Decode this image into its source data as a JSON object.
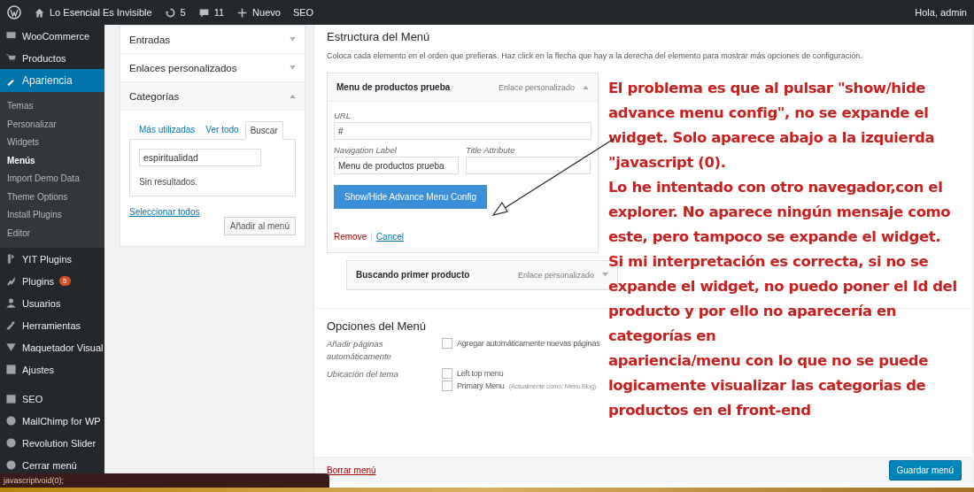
{
  "top_bar": {
    "site": "Lo Esencial Es Invisible",
    "updates": "5",
    "comments": "11",
    "new": "Nuevo",
    "seo": "SEO",
    "greeting": "Hola, admin"
  },
  "sidebar": {
    "items": [
      {
        "label": "WooCommerce",
        "selected": false
      },
      {
        "label": "Productos",
        "selected": false
      },
      {
        "label": "Apariencia",
        "selected": true,
        "children": [
          {
            "label": "Temas",
            "selected": false
          },
          {
            "label": "Personalizar",
            "selected": false
          },
          {
            "label": "Widgets",
            "selected": false
          },
          {
            "label": "Menús",
            "selected": true
          },
          {
            "label": "Import Demo Data",
            "selected": false
          },
          {
            "label": "Theme Options",
            "selected": false
          },
          {
            "label": "Install Plugins",
            "selected": false
          },
          {
            "label": "Editor",
            "selected": false
          }
        ]
      },
      {
        "label": "YIT Plugins",
        "selected": false
      },
      {
        "label": "Plugins",
        "selected": false,
        "badge": "5"
      },
      {
        "label": "Usuarios",
        "selected": false
      },
      {
        "label": "Herramientas",
        "selected": false
      },
      {
        "label": "Maquetador Visual",
        "selected": false
      },
      {
        "label": "Ajustes",
        "selected": false
      },
      {
        "label": "SEO",
        "selected": false,
        "separated": true
      },
      {
        "label": "MailChimp for WP",
        "selected": false
      },
      {
        "label": "Revolution Slider",
        "selected": false
      },
      {
        "label": "Cerrar menú",
        "selected": false
      }
    ]
  },
  "add_panel": {
    "sections": [
      {
        "title": "Entradas",
        "expanded": false
      },
      {
        "title": "Enlaces personalizados",
        "expanded": false
      },
      {
        "title": "Categorías",
        "expanded": true,
        "tabs": [
          {
            "label": "Más utilizadas",
            "selected": false
          },
          {
            "label": "Ver todo",
            "selected": false
          },
          {
            "label": "Buscar",
            "selected": true
          }
        ],
        "search_value": "espiritualidad",
        "result": "Sin resultados.",
        "select_all": "Seleccionar todos",
        "add_button": "Añadir al menú"
      }
    ]
  },
  "structure": {
    "title": "Estructura del Menú",
    "description": "Coloca cada elemento en el orden que prefieras. Haz click en la flecha que hay a la derecha del elemento para mostrar más opciones de configuración.",
    "items": [
      {
        "title": "Menu de productos prueba",
        "type": "Enlace personalizado",
        "expanded": true,
        "url_label": "URL",
        "url_value": "#",
        "nav_label": "Navigation Label",
        "nav_value": "Menu de productos prueba",
        "title_attr_label": "Title Attribute",
        "advanced_button": "Show/Hide Advance Menu Config",
        "remove": "Remove",
        "divider": "|",
        "cancel": "Cancel",
        "children": [
          {
            "title": "Buscando primer producto",
            "type": "Enlace personalizado",
            "expanded": false
          }
        ]
      }
    ]
  },
  "options": {
    "title": "Opciones del Menú",
    "rows": [
      {
        "label": "Añadir páginas automáticamente",
        "choices": [
          {
            "label": "Agregar automáticamente nuevas páginas",
            "checked": false
          }
        ]
      },
      {
        "label": "Ubicación del tema",
        "choices": [
          {
            "label": "Left top menu",
            "checked": false
          },
          {
            "label": "Primary Menu",
            "note": "(Actualmente como: Menu Blog)",
            "checked": false
          }
        ]
      }
    ]
  },
  "footer": {
    "delete": "Borrar menú",
    "save": "Guardar menú"
  },
  "annotation": "El problema es que al pulsar \"show/hide\nadvance menu config\", no se expande el\nwidget. Solo aparece abajo a la izquierda\n\"javascript (0).\nLo he intentado con otro navegador,con el\nexplorer. No aparece ningún mensaje como\neste, pero tampoco se expande el widget.\nSi mi interpretación es correcta, si no se\nexpande el widget, no puedo poner el Id del\nproducto y por ello no aparecería en\ncategorías en\napariencia/menu con lo que no se puede\nlogicamente visualizar las categorias de\nproductos en el front-end",
  "status_bar": "javascriptvoid(0);"
}
